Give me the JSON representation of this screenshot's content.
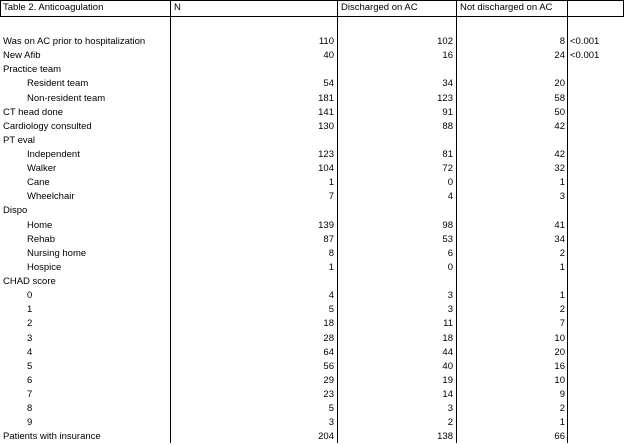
{
  "header": {
    "title": "Table 2. Anticoagulation",
    "col_n": "N",
    "col_discharged": "Discharged on AC",
    "col_not_discharged": "Not discharged on AC"
  },
  "rows": [
    {
      "label": "Was on AC prior to hospitalization",
      "n": "110",
      "dis": "102",
      "nd": "8",
      "p": "<0.001",
      "indent": 0
    },
    {
      "label": "New Afib",
      "n": "40",
      "dis": "16",
      "nd": "24",
      "p": "<0.001",
      "indent": 0
    },
    {
      "label": "Practice team",
      "n": "",
      "dis": "",
      "nd": "",
      "p": "",
      "indent": 0
    },
    {
      "label": "Resident team",
      "n": "54",
      "dis": "34",
      "nd": "20",
      "p": "",
      "indent": 1
    },
    {
      "label": "Non-resident team",
      "n": "181",
      "dis": "123",
      "nd": "58",
      "p": "",
      "indent": 1
    },
    {
      "label": "CT head done",
      "n": "141",
      "dis": "91",
      "nd": "50",
      "p": "",
      "indent": 0
    },
    {
      "label": "Cardiology consulted",
      "n": "130",
      "dis": "88",
      "nd": "42",
      "p": "",
      "indent": 0
    },
    {
      "label": "PT eval",
      "n": "",
      "dis": "",
      "nd": "",
      "p": "",
      "indent": 0
    },
    {
      "label": "Independent",
      "n": "123",
      "dis": "81",
      "nd": "42",
      "p": "",
      "indent": 1
    },
    {
      "label": "Walker",
      "n": "104",
      "dis": "72",
      "nd": "32",
      "p": "",
      "indent": 1
    },
    {
      "label": "Cane",
      "n": "1",
      "dis": "0",
      "nd": "1",
      "p": "",
      "indent": 1
    },
    {
      "label": "Wheelchair",
      "n": "7",
      "dis": "4",
      "nd": "3",
      "p": "",
      "indent": 1
    },
    {
      "label": "Dispo",
      "n": "",
      "dis": "",
      "nd": "",
      "p": "",
      "indent": 0
    },
    {
      "label": "Home",
      "n": "139",
      "dis": "98",
      "nd": "41",
      "p": "",
      "indent": 1
    },
    {
      "label": "Rehab",
      "n": "87",
      "dis": "53",
      "nd": "34",
      "p": "",
      "indent": 1
    },
    {
      "label": "Nursing home",
      "n": "8",
      "dis": "6",
      "nd": "2",
      "p": "",
      "indent": 1
    },
    {
      "label": "Hospice",
      "n": "1",
      "dis": "0",
      "nd": "1",
      "p": "",
      "indent": 1
    },
    {
      "label": "CHAD score",
      "n": "",
      "dis": "",
      "nd": "",
      "p": "",
      "indent": 0
    },
    {
      "label": "0",
      "n": "4",
      "dis": "3",
      "nd": "1",
      "p": "",
      "indent": 2
    },
    {
      "label": "1",
      "n": "5",
      "dis": "3",
      "nd": "2",
      "p": "",
      "indent": 2
    },
    {
      "label": "2",
      "n": "18",
      "dis": "11",
      "nd": "7",
      "p": "",
      "indent": 2
    },
    {
      "label": "3",
      "n": "28",
      "dis": "18",
      "nd": "10",
      "p": "",
      "indent": 2
    },
    {
      "label": "4",
      "n": "64",
      "dis": "44",
      "nd": "20",
      "p": "",
      "indent": 2
    },
    {
      "label": "5",
      "n": "56",
      "dis": "40",
      "nd": "16",
      "p": "",
      "indent": 2
    },
    {
      "label": "6",
      "n": "29",
      "dis": "19",
      "nd": "10",
      "p": "",
      "indent": 2
    },
    {
      "label": "7",
      "n": "23",
      "dis": "14",
      "nd": "9",
      "p": "",
      "indent": 2
    },
    {
      "label": "8",
      "n": "5",
      "dis": "3",
      "nd": "2",
      "p": "",
      "indent": 2
    },
    {
      "label": "9",
      "n": "3",
      "dis": "2",
      "nd": "1",
      "p": "",
      "indent": 2
    },
    {
      "label": "Patients with insurance",
      "n": "204",
      "dis": "138",
      "nd": "66",
      "p": "",
      "indent": 0
    }
  ]
}
